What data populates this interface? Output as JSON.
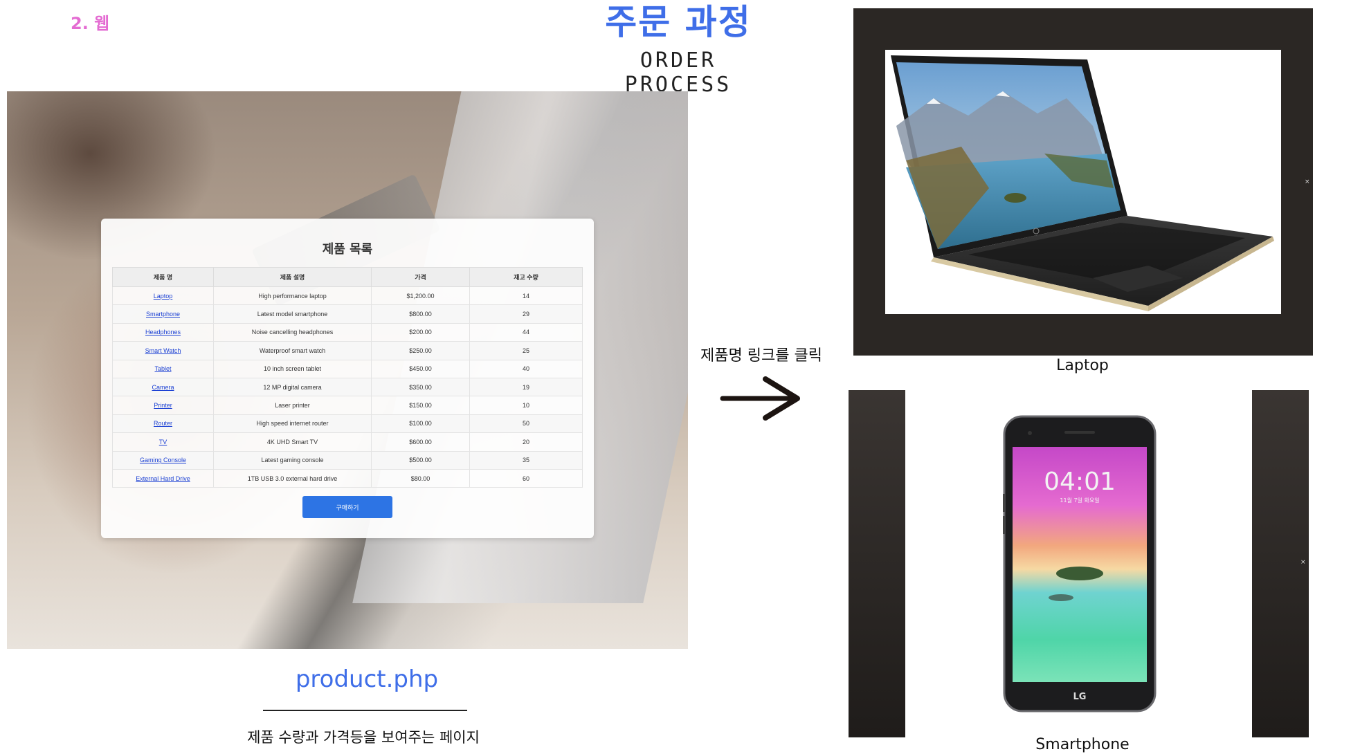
{
  "header": {
    "section": "2. 웹",
    "title": "주문 과정",
    "subtitle": "ORDER PROCESS"
  },
  "product_page": {
    "panel_title": "제품 목록",
    "columns": [
      "제품 명",
      "제품 설명",
      "가격",
      "재고 수량"
    ],
    "rows": [
      {
        "name": "Laptop",
        "desc": "High performance laptop",
        "price": "$1,200.00",
        "stock": "14"
      },
      {
        "name": "Smartphone",
        "desc": "Latest model smartphone",
        "price": "$800.00",
        "stock": "29"
      },
      {
        "name": "Headphones",
        "desc": "Noise cancelling headphones",
        "price": "$200.00",
        "stock": "44"
      },
      {
        "name": "Smart Watch",
        "desc": "Waterproof smart watch",
        "price": "$250.00",
        "stock": "25"
      },
      {
        "name": "Tablet",
        "desc": "10 inch screen tablet",
        "price": "$450.00",
        "stock": "40"
      },
      {
        "name": "Camera",
        "desc": "12 MP digital camera",
        "price": "$350.00",
        "stock": "19"
      },
      {
        "name": "Printer",
        "desc": "Laser printer",
        "price": "$150.00",
        "stock": "10"
      },
      {
        "name": "Router",
        "desc": "High speed internet router",
        "price": "$100.00",
        "stock": "50"
      },
      {
        "name": "TV",
        "desc": "4K UHD Smart TV",
        "price": "$600.00",
        "stock": "20"
      },
      {
        "name": "Gaming Console",
        "desc": "Latest gaming console",
        "price": "$500.00",
        "stock": "35"
      },
      {
        "name": "External Hard Drive",
        "desc": "1TB USB 3.0 external hard drive",
        "price": "$80.00",
        "stock": "60"
      }
    ],
    "buy_button": "구매하기"
  },
  "footer": {
    "file_name": "product.php",
    "description": "제품 수량과 가격등을 보여주는 페이지"
  },
  "flow": {
    "click_note": "제품명 링크를 클릭"
  },
  "modals": {
    "laptop_caption": "Laptop",
    "smartphone_caption": "Smartphone",
    "close_glyph": "×",
    "phone_time": "04:01",
    "phone_date": "11월 7일 화요일",
    "phone_brand": "LG"
  },
  "icons": [
    "arrow-right-icon",
    "close-icon",
    "hp-logo-icon",
    "lg-logo-icon"
  ],
  "colors": {
    "accent_blue": "#3f6ee8",
    "section_pink": "#e46bd2",
    "button_blue": "#2d74e4",
    "link_blue": "#1a3fd3",
    "modal_bg": "#2b2724"
  }
}
